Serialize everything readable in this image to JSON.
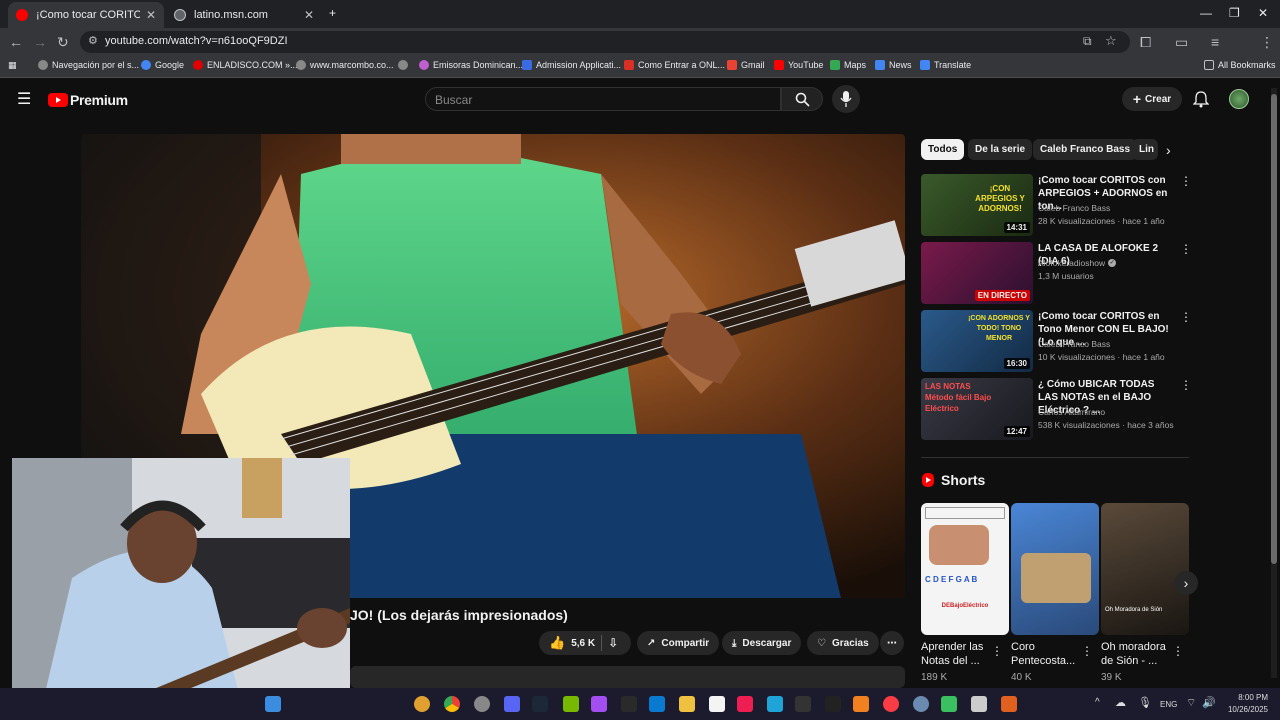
{
  "tabs": [
    {
      "title": "¡Como tocar CORITOS Tono Ma",
      "active": true
    },
    {
      "title": "latino.msn.com",
      "active": false
    }
  ],
  "address": {
    "url": "youtube.com/watch?v=n61ooQF9DZI"
  },
  "bookmarks": [
    "Navegación por el s...",
    "Google",
    "ENLADISCO.COM »...",
    "www.marcombo.co...",
    "Emisoras Dominican...",
    "Admission Applicati...",
    "Como Entrar a ONL...",
    "Gmail",
    "YouTube",
    "Maps",
    "News",
    "Translate"
  ],
  "all_bookmarks": "All Bookmarks",
  "youtube": {
    "logo": "Premium",
    "search_placeholder": "Buscar",
    "create_label": "Crear"
  },
  "video": {
    "title_visible": "JO! (Los dejarás impresionados)",
    "likes": "5,6 K",
    "share": "Compartir",
    "download": "Descargar",
    "thanks": "Gracias"
  },
  "chips": [
    "Todos",
    "De la serie",
    "Caleb Franco Bass",
    "Lin"
  ],
  "recommendations": [
    {
      "title": "¡Como tocar CORITOS con ARPEGIOS + ADORNOS en ton...",
      "channel": "Caleb Franco Bass",
      "meta": "28 K visualizaciones · hace 1 año",
      "duration": "14:31",
      "thumb_text": "¡CON ARPEGIOS Y ADORNOS!",
      "verified": false
    },
    {
      "title": "LA CASA DE ALOFOKE 2 (DIA 6)",
      "channel": "Alofokeradioshow",
      "meta": "1,3 M usuarios",
      "duration": "EN DIRECTO",
      "thumb_text": "",
      "verified": true
    },
    {
      "title": "¡Como tocar CORITOS en Tono Menor CON EL BAJO! (Lo que ...",
      "channel": "Caleb Franco Bass",
      "meta": "10 K visualizaciones · hace 1 año",
      "duration": "16:30",
      "thumb_text": "¡CON ADORNOS Y TODO! TONO MENOR",
      "verified": false
    },
    {
      "title": "¿ Cómo UBICAR TODAS LAS NOTAS en el BAJO Eléctrico ? ...",
      "channel": "Carlos Altamirano",
      "meta": "538 K visualizaciones · hace 3 años",
      "duration": "12:47",
      "thumb_text": "LAS NOTAS Método fácil Bajo Eléctrico",
      "verified": false
    }
  ],
  "shorts": {
    "heading": "Shorts",
    "items": [
      {
        "title": "Aprender las Notas del ...",
        "views": "189 K",
        "thumb_text": "DEBajoEléctrico"
      },
      {
        "title": "Coro Pentecosta...",
        "views": "40 K",
        "thumb_text": ""
      },
      {
        "title": "Oh moradora de Sión - ...",
        "views": "39 K",
        "thumb_text": "Oh Moradora de Sión"
      }
    ]
  },
  "tray": {
    "lang": "ENG",
    "time": "8:00 PM",
    "date": "10/26/2025"
  },
  "colors": {
    "yt_red": "#ff0000",
    "bg": "#0f0f0f",
    "chrome_dark": "#202124",
    "chrome_bar": "#35363a"
  }
}
